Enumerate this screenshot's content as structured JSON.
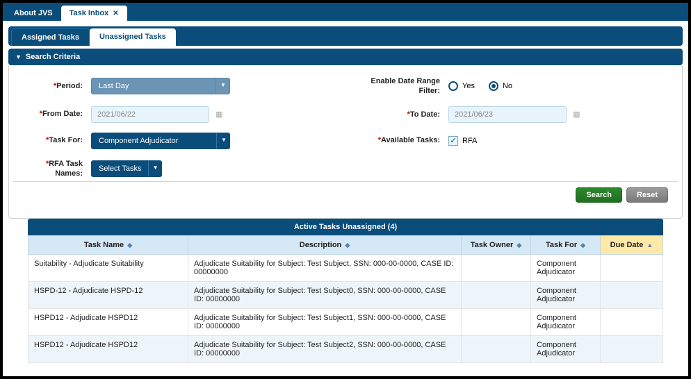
{
  "topTabs": {
    "about": "About JVS",
    "inbox": "Task Inbox"
  },
  "subTabs": {
    "assigned": "Assigned Tasks",
    "unassigned": "Unassigned Tasks"
  },
  "panel": {
    "title": "Search Criteria"
  },
  "labels": {
    "period": "Period:",
    "fromDate": "From Date:",
    "taskFor": "Task For:",
    "rfaTaskNames": "RFA Task Names:",
    "enableDateRange": "Enable Date Range Filter:",
    "toDate": "To Date:",
    "availableTasks": "Available Tasks:"
  },
  "values": {
    "period": "Last Day",
    "fromDate": "2021/06/22",
    "taskFor": "Component Adjudicator",
    "rfaTaskNames": "Select Tasks",
    "toDate": "2021/06/23",
    "yes": "Yes",
    "no": "No",
    "rfa": "RFA"
  },
  "buttons": {
    "search": "Search",
    "reset": "Reset"
  },
  "table": {
    "title": "Active Tasks Unassigned (4)",
    "headers": {
      "taskName": "Task Name",
      "description": "Description",
      "taskOwner": "Task Owner",
      "taskFor": "Task For",
      "dueDate": "Due Date"
    },
    "rows": [
      {
        "name": "Suitability - Adjudicate Suitability",
        "desc": "Adjudicate Suitability for Subject: Test Subject, SSN: 000-00-0000, CASE ID: 00000000",
        "owner": "",
        "for": "Component Adjudicator",
        "due": ""
      },
      {
        "name": "HSPD-12 - Adjudicate HSPD-12",
        "desc": "Adjudicate Suitability for Subject: Test Subject0, SSN: 000-00-0000, CASE ID: 00000000",
        "owner": "",
        "for": "Component Adjudicator",
        "due": ""
      },
      {
        "name": "HSPD12 - Adjudicate HSPD12",
        "desc": "Adjudicate Suitability for Subject: Test Subject1, SSN: 000-00-0000, CASE ID: 00000000",
        "owner": "",
        "for": "Component Adjudicator",
        "due": ""
      },
      {
        "name": "HSPD12 - Adjudicate HSPD12",
        "desc": "Adjudicate Suitability for Subject: Test Subject2, SSN: 000-00-0000, CASE ID: 00000000",
        "owner": "",
        "for": "Component Adjudicator",
        "due": ""
      }
    ]
  }
}
